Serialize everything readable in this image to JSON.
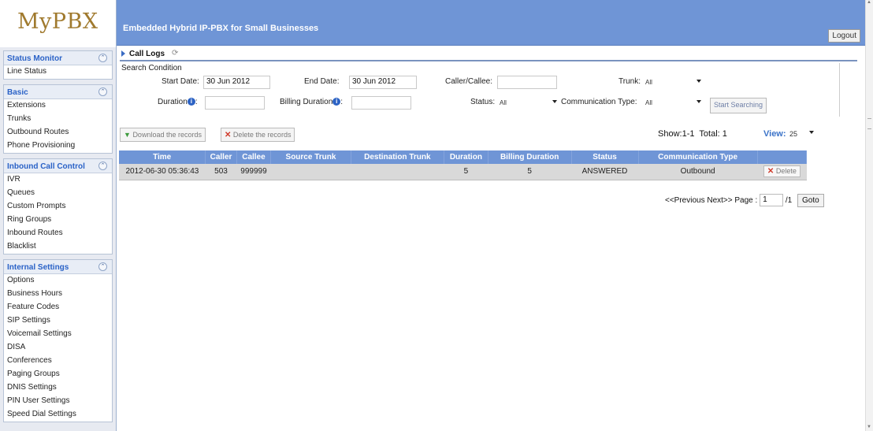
{
  "app": {
    "logo": "MyPBX",
    "subtitle": "Embedded Hybrid IP-PBX for Small Businesses",
    "logout": "Logout"
  },
  "sidebar": {
    "sections": [
      {
        "title": "Status Monitor",
        "items": [
          "Line Status"
        ]
      },
      {
        "title": "Basic",
        "items": [
          "Extensions",
          "Trunks",
          "Outbound Routes",
          "Phone Provisioning"
        ]
      },
      {
        "title": "Inbound Call Control",
        "items": [
          "IVR",
          "Queues",
          "Custom Prompts",
          "Ring Groups",
          "Inbound Routes",
          "Blacklist"
        ]
      },
      {
        "title": "Internal Settings",
        "items": [
          "Options",
          "Business Hours",
          "Feature Codes",
          "SIP Settings",
          "Voicemail Settings",
          "DISA",
          "Conferences",
          "Paging Groups",
          "DNIS Settings",
          "PIN User Settings",
          "Speed Dial Settings"
        ]
      }
    ]
  },
  "page": {
    "title": "Call Logs"
  },
  "search": {
    "title": "Search Condition",
    "start_date_label": "Start Date:",
    "start_date": "30 Jun 2012",
    "end_date_label": "End Date:",
    "end_date": "30 Jun 2012",
    "caller_label": "Caller/Callee:",
    "caller_value": "",
    "trunk_label": "Trunk:",
    "trunk_value": "All",
    "duration_label": "Duration",
    "duration_colon": ":",
    "billing_label": "Billing Duration",
    "billing_colon": ":",
    "status_label": "Status:",
    "status_value": "All",
    "comm_type_label": "Communication Type:",
    "comm_type_value": "All",
    "start_button": "Start Searching"
  },
  "actions": {
    "download": "Download the records",
    "delete": "Delete the records"
  },
  "summary": {
    "show": "Show:1-1",
    "total": "Total: 1",
    "view_label": "View:",
    "view_value": "25"
  },
  "table": {
    "headers": [
      "Time",
      "Caller",
      "Callee",
      "Source Trunk",
      "Destination Trunk",
      "Duration",
      "Billing Duration",
      "Status",
      "Communication Type",
      ""
    ],
    "rows": [
      {
        "time": "2012-06-30 05:36:43",
        "caller": "503",
        "callee": "999999",
        "source_trunk": "",
        "destination_trunk": "",
        "duration": "5",
        "billing_duration": "5",
        "status": "ANSWERED",
        "communication_type": "Outbound",
        "delete_label": "Delete"
      }
    ]
  },
  "pager": {
    "prev_next": "<<Previous Next>> Page :",
    "page": "1",
    "of_total": "/1",
    "goto": "Goto"
  }
}
